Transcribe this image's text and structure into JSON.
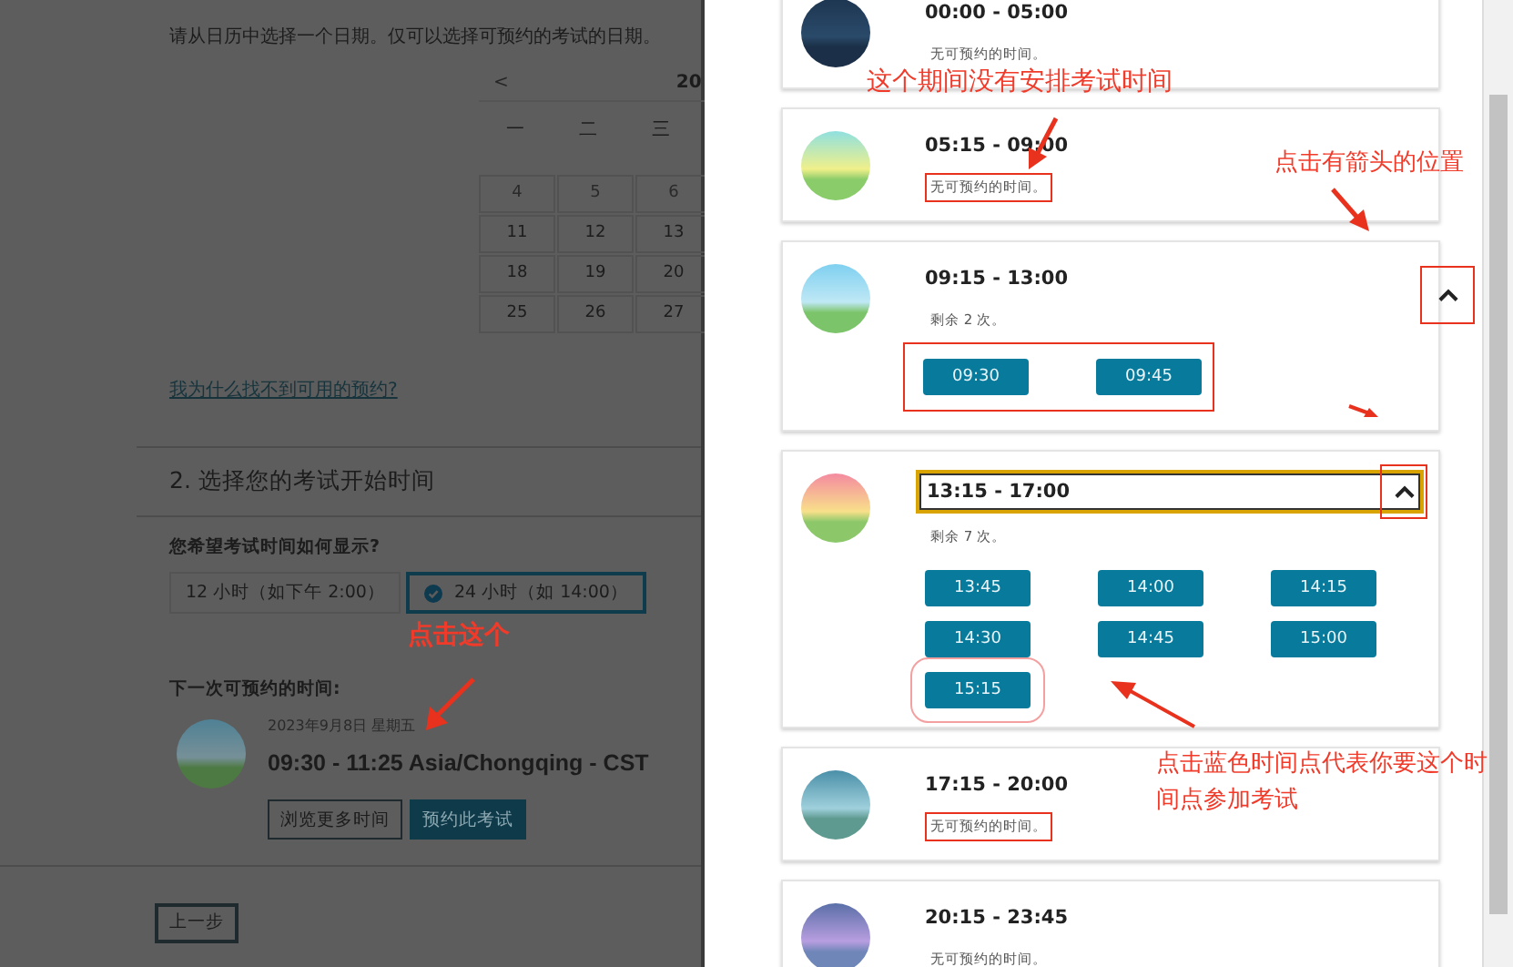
{
  "left": {
    "instruction": "请从日历中选择一个日期。仅可以选择可预约的考试的日期。",
    "calendar": {
      "prev": "<",
      "month": "20",
      "weekdays": [
        "一",
        "二",
        "三"
      ],
      "weeks": [
        [
          "4",
          "5",
          "6"
        ],
        [
          "11",
          "12",
          "13"
        ],
        [
          "18",
          "19",
          "20"
        ],
        [
          "25",
          "26",
          "27"
        ]
      ]
    },
    "help_link": "我为什么找不到可用的预约?",
    "section_title": "2. 选择您的考试开始时间",
    "format_question": "您希望考试时间如何显示?",
    "formats": [
      {
        "label": "12 小时（如下午 2:00）",
        "selected": false
      },
      {
        "label": "24 小时（如 14:00）",
        "selected": true
      }
    ],
    "next_label": "下一次可预约的时间:",
    "next_date": "2023年9月8日 星期五",
    "next_time": "09:30 - 11:25 Asia/Chongqing - CST",
    "buttons": [
      {
        "label": "浏览更多时间",
        "kind": "outline"
      },
      {
        "label": "预约此考试",
        "kind": "primary"
      }
    ],
    "back": "上一步"
  },
  "periods": [
    {
      "time": "00:00 - 05:00",
      "status": "无可预约的时间。",
      "expanded": false,
      "focused": false,
      "status_marked": false
    },
    {
      "time": "05:15 - 09:00",
      "status": "无可预约的时间。",
      "expanded": false,
      "focused": false,
      "status_marked": true
    },
    {
      "time": "09:15 - 13:00",
      "status": "剩余 2 次。",
      "expanded": true,
      "focused": false,
      "status_marked": false,
      "slots_marked": true,
      "slots": [
        {
          "label": "09:30"
        },
        {
          "label": "09:45"
        }
      ]
    },
    {
      "time": "13:15 - 17:00",
      "status": "剩余 7 次。",
      "expanded": true,
      "focused": true,
      "status_marked": false,
      "slots_marked": false,
      "slots": [
        {
          "label": "13:45",
          "marked": false
        },
        {
          "label": "14:00",
          "marked": false
        },
        {
          "label": "14:15",
          "marked": false
        },
        {
          "label": "14:30",
          "marked": false
        },
        {
          "label": "14:45",
          "marked": false
        },
        {
          "label": "15:00",
          "marked": false
        },
        {
          "label": "15:15",
          "marked": true
        }
      ]
    },
    {
      "time": "17:15 - 20:00",
      "status": "无可预约的时间。",
      "expanded": false,
      "focused": false,
      "status_marked": true
    },
    {
      "time": "20:15 - 23:45",
      "status": "无可预约的时间。",
      "expanded": false,
      "focused": false,
      "status_marked": false
    }
  ],
  "annotations": [
    "点击这个",
    "这个期间没有安排考试时间",
    "点击有箭头的位置",
    "点击蓝色时间点代表你要这个时间点参加考试"
  ]
}
